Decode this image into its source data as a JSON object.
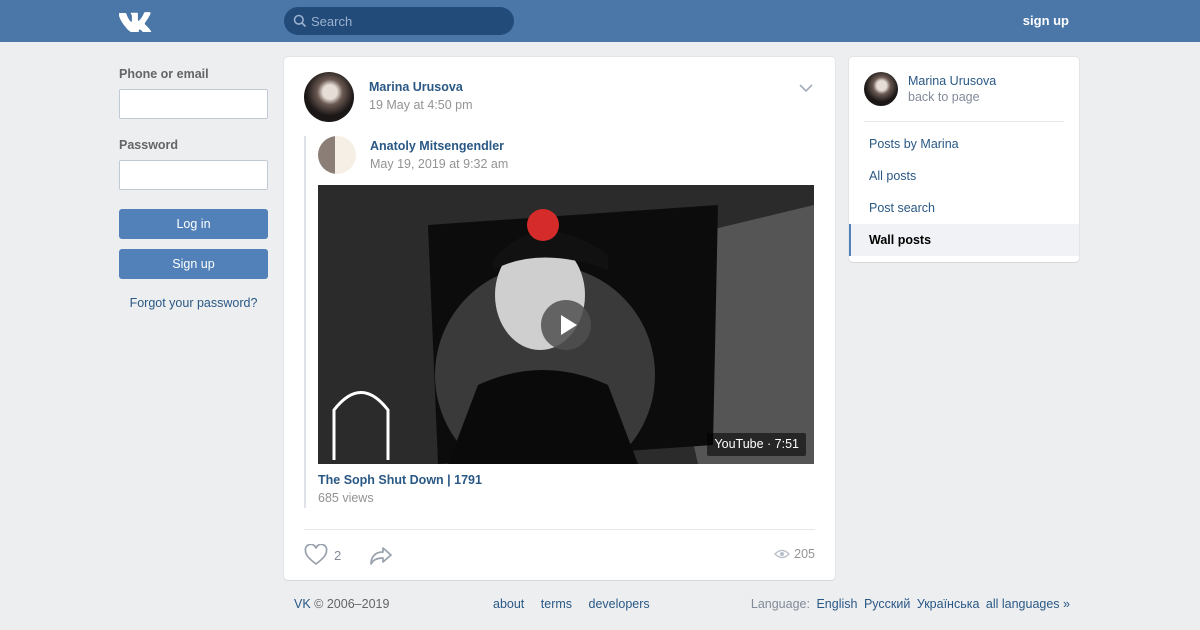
{
  "header": {
    "search_placeholder": "Search",
    "signup_label": "sign up",
    "brand_color": "#4a76a8"
  },
  "login": {
    "phone_label": "Phone or email",
    "password_label": "Password",
    "login_button": "Log in",
    "signup_button": "Sign up",
    "forgot_link": "Forgot your password?"
  },
  "post": {
    "author": "Marina Urusova",
    "date": "19 May at 4:50 pm",
    "repost": {
      "author": "Anatoly Mitsengendler",
      "date": "May 19, 2019 at 9:32 am"
    },
    "video": {
      "duration": "YouTube · 7:51",
      "title": "The Soph Shut Down | 1791",
      "views": "685 views"
    },
    "likes": "2",
    "views": "205"
  },
  "sidebar": {
    "name": "Marina Urusova",
    "back": "back to page",
    "items": [
      {
        "label": "Posts by Marina",
        "active": false
      },
      {
        "label": "All posts",
        "active": false
      },
      {
        "label": "Post search",
        "active": false
      },
      {
        "label": "Wall posts",
        "active": true
      }
    ]
  },
  "footer": {
    "copyright_brand": "VK",
    "copyright_years": "© 2006–2019",
    "links": [
      "about",
      "terms",
      "developers"
    ],
    "language_label": "Language:",
    "languages": [
      "English",
      "Русский",
      "Українська",
      "all languages »"
    ]
  }
}
